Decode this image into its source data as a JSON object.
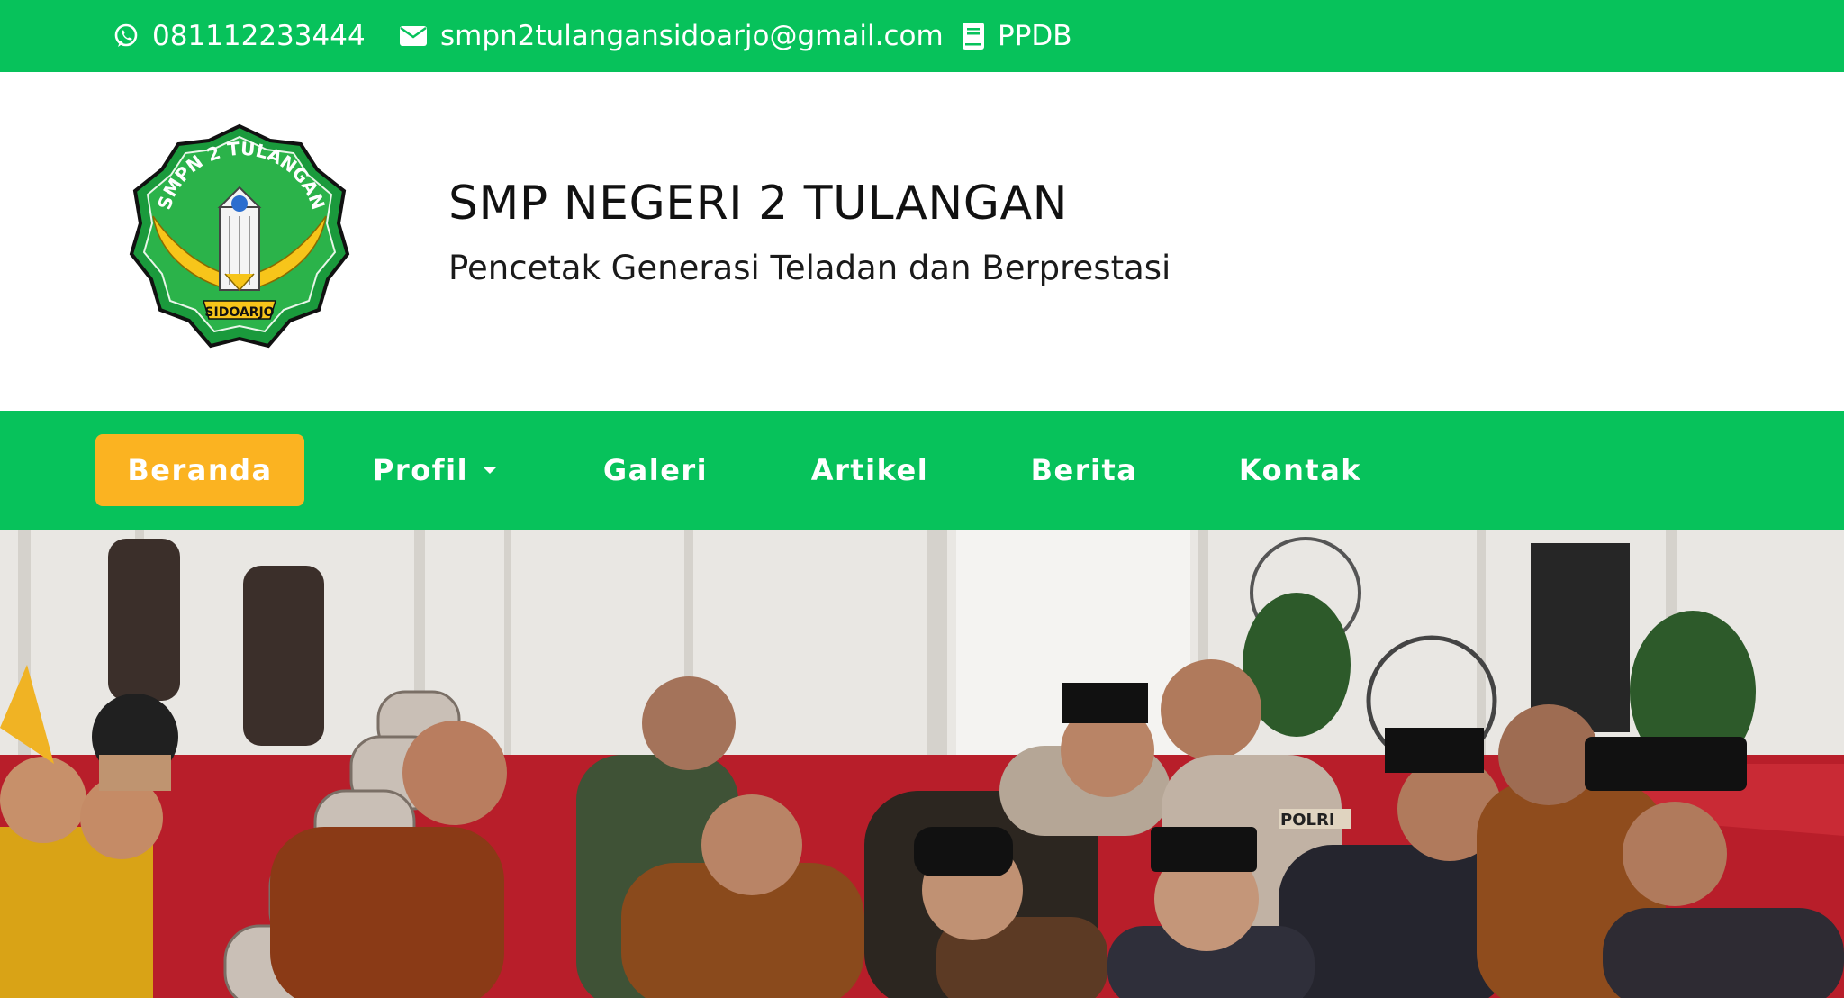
{
  "topbar": {
    "phone": "081112233444",
    "email": "smpn2tulangansidoarjo@gmail.com",
    "ppdb": "PPDB",
    "background": "#07c25b",
    "icons": [
      "whatsapp-icon",
      "envelope-icon",
      "book-icon"
    ]
  },
  "header": {
    "logo_text_top": "SMPN 2 TULANGAN",
    "logo_text_bottom": "SIDOARJO",
    "school_name": "SMP NEGERI 2 TULANGAN",
    "motto": "Pencetak Generasi Teladan dan Berprestasi"
  },
  "nav": {
    "background": "#07c25b",
    "active_color": "#fbb321",
    "items": [
      {
        "label": "Beranda",
        "active": true
      },
      {
        "label": "Profil",
        "dropdown": true
      },
      {
        "label": "Galeri"
      },
      {
        "label": "Artikel"
      },
      {
        "label": "Berita"
      },
      {
        "label": "Kontak"
      }
    ]
  },
  "hero": {
    "visible_text": [
      "POLRI"
    ]
  }
}
